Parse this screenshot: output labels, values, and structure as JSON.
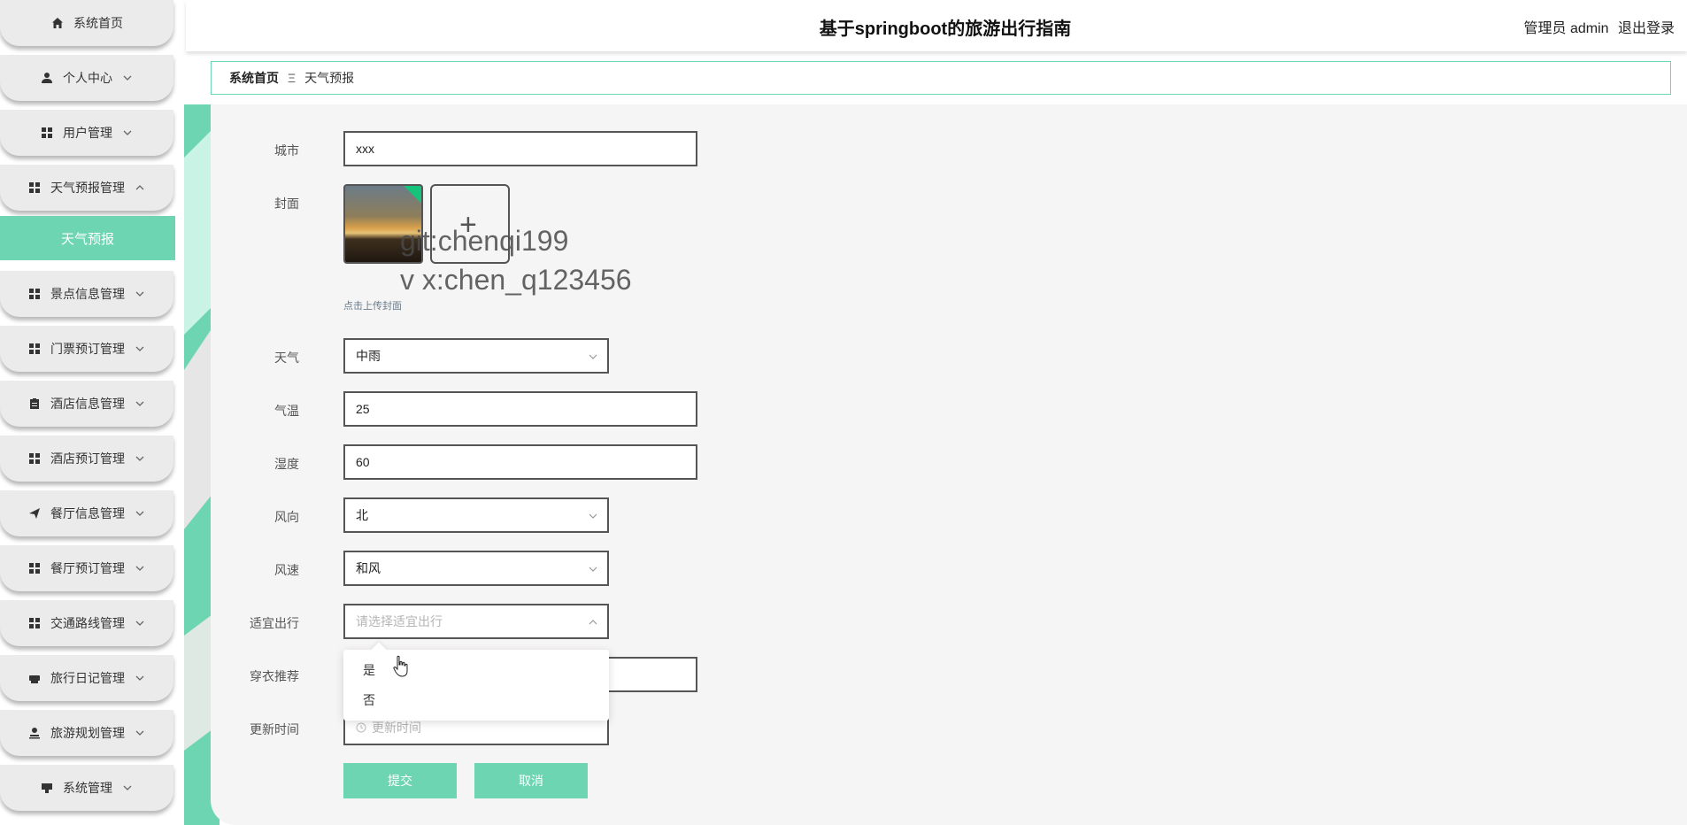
{
  "header": {
    "title": "基于springboot的旅游出行指南",
    "user_label": "管理员 admin",
    "logout_label": "退出登录"
  },
  "sidebar": {
    "items": [
      {
        "label": "系统首页",
        "icon": "home-icon",
        "chevron": false
      },
      {
        "label": "个人中心",
        "icon": "user-icon",
        "chevron": true
      },
      {
        "label": "用户管理",
        "icon": "grid-icon",
        "chevron": true
      },
      {
        "label": "天气预报管理",
        "icon": "grid-icon",
        "chevron": true,
        "expanded": true
      },
      {
        "label": "景点信息管理",
        "icon": "grid-icon",
        "chevron": true
      },
      {
        "label": "门票预订管理",
        "icon": "grid-icon",
        "chevron": true
      },
      {
        "label": "酒店信息管理",
        "icon": "clipboard-icon",
        "chevron": true
      },
      {
        "label": "酒店预订管理",
        "icon": "grid-icon",
        "chevron": true
      },
      {
        "label": "餐厅信息管理",
        "icon": "send-icon",
        "chevron": true
      },
      {
        "label": "餐厅预订管理",
        "icon": "grid-icon",
        "chevron": true
      },
      {
        "label": "交通路线管理",
        "icon": "grid-icon",
        "chevron": true
      },
      {
        "label": "旅行日记管理",
        "icon": "printer-icon",
        "chevron": true
      },
      {
        "label": "旅游规划管理",
        "icon": "stamp-icon",
        "chevron": true
      },
      {
        "label": "系统管理",
        "icon": "monitor-icon",
        "chevron": true
      }
    ],
    "active_sub": "天气预报"
  },
  "breadcrumb": {
    "home": "系统首页",
    "separator": "Ξ",
    "current": "天气预报"
  },
  "form": {
    "city": {
      "label": "城市",
      "value": "xxx"
    },
    "cover": {
      "label": "封面",
      "hint": "点击上传封面"
    },
    "weather": {
      "label": "天气",
      "value": "中雨"
    },
    "temperature": {
      "label": "气温",
      "value": "25"
    },
    "humidity": {
      "label": "湿度",
      "value": "60"
    },
    "wind_direction": {
      "label": "风向",
      "value": "北"
    },
    "wind_speed": {
      "label": "风速",
      "value": "和风"
    },
    "travel_suitable": {
      "label": "适宜出行",
      "placeholder": "请选择适宜出行",
      "options": [
        "是",
        "否"
      ]
    },
    "clothing": {
      "label": "穿衣推荐",
      "value": ""
    },
    "update_time": {
      "label": "更新时间",
      "placeholder": "更新时间"
    },
    "submit_label": "提交",
    "cancel_label": "取消"
  },
  "watermark": {
    "line1": "git:chenqi199",
    "line2": "v x:chen_q123456"
  },
  "colors": {
    "accent": "#6dd5b1",
    "content_bg": "#f6f5f5",
    "menu_bg": "#ebebeb"
  }
}
